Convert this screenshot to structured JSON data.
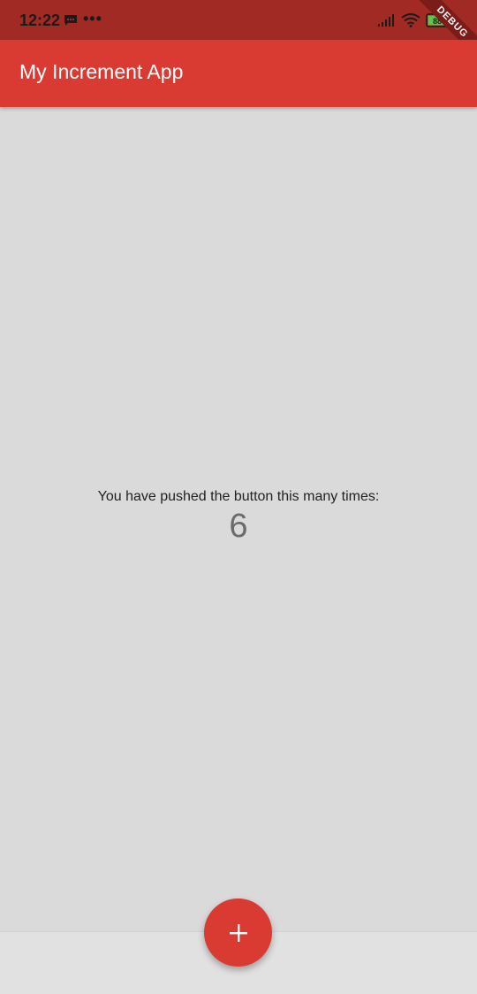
{
  "status_bar": {
    "time": "12:22",
    "message_icon": "message-icon",
    "more_indicator": "•••",
    "signal_icon": "signal-icon",
    "wifi_icon": "wifi-icon",
    "battery_icon": "battery-icon",
    "battery_level": "88"
  },
  "debug_banner": {
    "label": "DEBUG"
  },
  "app_bar": {
    "title": "My Increment App",
    "color": "#d93a31"
  },
  "main": {
    "counter_label": "You have pushed the button this many times:",
    "counter_value": "6"
  },
  "fab": {
    "icon": "plus-icon",
    "color": "#d93a31"
  }
}
